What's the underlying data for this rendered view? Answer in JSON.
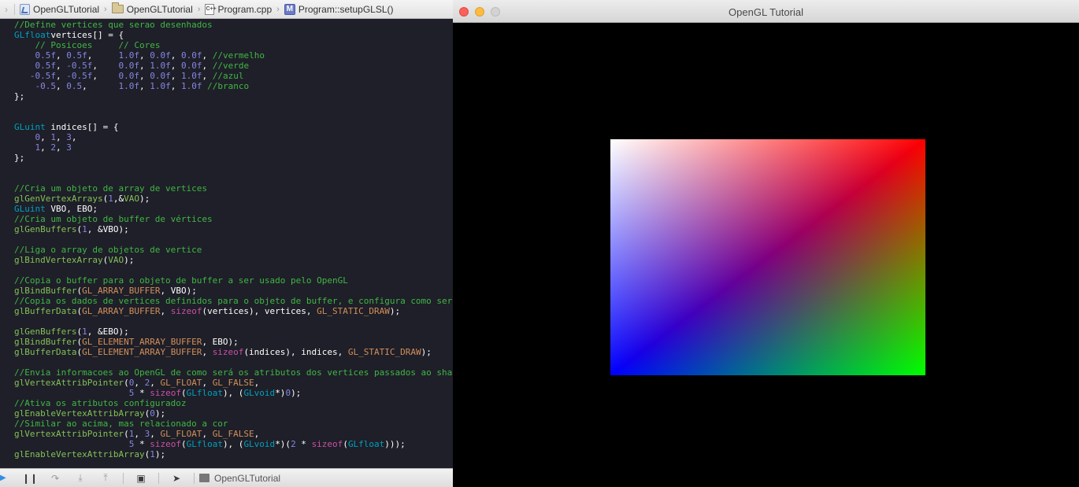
{
  "editor": {
    "jumpbar": {
      "crumbs": [
        "OpenGLTutorial",
        "OpenGLTutorial",
        "Program.cpp",
        "Program::setupGLSL()"
      ],
      "cpp_badge": "C++",
      "method_badge": "M"
    },
    "code": [
      [
        [
          "cm",
          "//Define vertices que serao desenhados"
        ]
      ],
      [
        [
          "ty",
          "GLfloat"
        ],
        [
          "",
          "vertices[] = {"
        ]
      ],
      [
        [
          "",
          "    "
        ],
        [
          "cm",
          "// Posicoes     // Cores"
        ]
      ],
      [
        [
          "",
          "    "
        ],
        [
          "nu",
          "0.5f"
        ],
        [
          "",
          ", "
        ],
        [
          "nu",
          "0.5f"
        ],
        [
          "",
          ",     "
        ],
        [
          "nu",
          "1.0f"
        ],
        [
          "",
          ", "
        ],
        [
          "nu",
          "0.0f"
        ],
        [
          "",
          ", "
        ],
        [
          "nu",
          "0.0f"
        ],
        [
          "",
          ", "
        ],
        [
          "cm",
          "//vermelho"
        ]
      ],
      [
        [
          "",
          "    "
        ],
        [
          "nu",
          "0.5f"
        ],
        [
          "",
          ", "
        ],
        [
          "nu",
          "-0.5f"
        ],
        [
          "",
          ",    "
        ],
        [
          "nu",
          "0.0f"
        ],
        [
          "",
          ", "
        ],
        [
          "nu",
          "1.0f"
        ],
        [
          "",
          ", "
        ],
        [
          "nu",
          "0.0f"
        ],
        [
          "",
          ", "
        ],
        [
          "cm",
          "//verde"
        ]
      ],
      [
        [
          "",
          "   "
        ],
        [
          "nu",
          "-0.5f"
        ],
        [
          "",
          ", "
        ],
        [
          "nu",
          "-0.5f"
        ],
        [
          "",
          ",    "
        ],
        [
          "nu",
          "0.0f"
        ],
        [
          "",
          ", "
        ],
        [
          "nu",
          "0.0f"
        ],
        [
          "",
          ", "
        ],
        [
          "nu",
          "1.0f"
        ],
        [
          "",
          ", "
        ],
        [
          "cm",
          "//azul"
        ]
      ],
      [
        [
          "",
          "    "
        ],
        [
          "nu",
          "-0.5"
        ],
        [
          "",
          ", "
        ],
        [
          "nu",
          "0.5"
        ],
        [
          "",
          ",      "
        ],
        [
          "nu",
          "1.0f"
        ],
        [
          "",
          ", "
        ],
        [
          "nu",
          "1.0f"
        ],
        [
          "",
          ", "
        ],
        [
          "nu",
          "1.0f"
        ],
        [
          "cm",
          " //branco"
        ]
      ],
      [
        [
          "",
          "};"
        ]
      ],
      [],
      [],
      [
        [
          "ty",
          "GLuint"
        ],
        [
          "",
          " indices[] = {"
        ]
      ],
      [
        [
          "",
          "    "
        ],
        [
          "nu",
          "0"
        ],
        [
          "",
          ", "
        ],
        [
          "nu",
          "1"
        ],
        [
          "",
          ", "
        ],
        [
          "nu",
          "3"
        ],
        [
          "",
          ","
        ]
      ],
      [
        [
          "",
          "    "
        ],
        [
          "nu",
          "1"
        ],
        [
          "",
          ", "
        ],
        [
          "nu",
          "2"
        ],
        [
          "",
          ", "
        ],
        [
          "nu",
          "3"
        ]
      ],
      [
        [
          "",
          "};"
        ]
      ],
      [],
      [],
      [
        [
          "cm",
          "//Cria um objeto de array de vertices"
        ]
      ],
      [
        [
          "fn",
          "glGenVertexArrays"
        ],
        [
          "",
          "("
        ],
        [
          "nu",
          "1"
        ],
        [
          "",
          ",&"
        ],
        [
          "fn",
          "VAO"
        ],
        [
          "",
          ");"
        ]
      ],
      [
        [
          "ty",
          "GLuint"
        ],
        [
          "",
          " VBO, EBO;"
        ]
      ],
      [
        [
          "cm",
          "//Cria um objeto de buffer de vértices"
        ]
      ],
      [
        [
          "fn",
          "glGenBuffers"
        ],
        [
          "",
          "("
        ],
        [
          "nu",
          "1"
        ],
        [
          "",
          ", &VBO);"
        ]
      ],
      [],
      [
        [
          "cm",
          "//Liga o array de objetos de vertice"
        ]
      ],
      [
        [
          "fn",
          "glBindVertexArray"
        ],
        [
          "",
          "("
        ],
        [
          "fn",
          "VAO"
        ],
        [
          "",
          ");"
        ]
      ],
      [],
      [
        [
          "cm",
          "//Copia o buffer para o objeto de buffer a ser usado pelo OpenGL"
        ]
      ],
      [
        [
          "fn",
          "glBindBuffer"
        ],
        [
          "",
          "("
        ],
        [
          "mc",
          "GL_ARRAY_BUFFER"
        ],
        [
          "",
          ", VBO);"
        ]
      ],
      [
        [
          "cm",
          "//Copia os dados de vertices definidos para o objeto de buffer, e configura como ser"
        ]
      ],
      [
        [
          "fn",
          "glBufferData"
        ],
        [
          "",
          "("
        ],
        [
          "mc",
          "GL_ARRAY_BUFFER"
        ],
        [
          "",
          ", "
        ],
        [
          "kw",
          "sizeof"
        ],
        [
          "",
          "(vertices), vertices, "
        ],
        [
          "mc",
          "GL_STATIC_DRAW"
        ],
        [
          "",
          ");"
        ]
      ],
      [],
      [
        [
          "fn",
          "glGenBuffers"
        ],
        [
          "",
          "("
        ],
        [
          "nu",
          "1"
        ],
        [
          "",
          ", &EBO);"
        ]
      ],
      [
        [
          "fn",
          "glBindBuffer"
        ],
        [
          "",
          "("
        ],
        [
          "mc",
          "GL_ELEMENT_ARRAY_BUFFER"
        ],
        [
          "",
          ", EBO);"
        ]
      ],
      [
        [
          "fn",
          "glBufferData"
        ],
        [
          "",
          "("
        ],
        [
          "mc",
          "GL_ELEMENT_ARRAY_BUFFER"
        ],
        [
          "",
          ", "
        ],
        [
          "kw",
          "sizeof"
        ],
        [
          "",
          "(indices), indices, "
        ],
        [
          "mc",
          "GL_STATIC_DRAW"
        ],
        [
          "",
          ");"
        ]
      ],
      [],
      [
        [
          "cm",
          "//Envia informacoes ao OpenGL de como será os atributos dos vertices passados ao sha"
        ]
      ],
      [
        [
          "fn",
          "glVertexAttribPointer"
        ],
        [
          "",
          "("
        ],
        [
          "nu",
          "0"
        ],
        [
          "",
          ", "
        ],
        [
          "nu",
          "2"
        ],
        [
          "",
          ", "
        ],
        [
          "mc",
          "GL_FLOAT"
        ],
        [
          "",
          ", "
        ],
        [
          "mc",
          "GL_FALSE"
        ],
        [
          "",
          ","
        ]
      ],
      [
        [
          "",
          "                      "
        ],
        [
          "nu",
          "5"
        ],
        [
          "",
          " * "
        ],
        [
          "kw",
          "sizeof"
        ],
        [
          "",
          "("
        ],
        [
          "ty",
          "GLfloat"
        ],
        [
          "",
          "), ("
        ],
        [
          "ty",
          "GLvoid"
        ],
        [
          "",
          "*)"
        ],
        [
          "nu",
          "0"
        ],
        [
          "",
          ");"
        ]
      ],
      [
        [
          "cm",
          "//Ativa os atributos configuradoz"
        ]
      ],
      [
        [
          "fn",
          "glEnableVertexAttribArray"
        ],
        [
          "",
          "("
        ],
        [
          "nu",
          "0"
        ],
        [
          "",
          ");"
        ]
      ],
      [
        [
          "cm",
          "//Similar ao acima, mas relacionado a cor"
        ]
      ],
      [
        [
          "fn",
          "glVertexAttribPointer"
        ],
        [
          "",
          "("
        ],
        [
          "nu",
          "1"
        ],
        [
          "",
          ", "
        ],
        [
          "nu",
          "3"
        ],
        [
          "",
          ", "
        ],
        [
          "mc",
          "GL_FLOAT"
        ],
        [
          "",
          ", "
        ],
        [
          "mc",
          "GL_FALSE"
        ],
        [
          "",
          ","
        ]
      ],
      [
        [
          "",
          "                      "
        ],
        [
          "nu",
          "5"
        ],
        [
          "",
          " * "
        ],
        [
          "kw",
          "sizeof"
        ],
        [
          "",
          "("
        ],
        [
          "ty",
          "GLfloat"
        ],
        [
          "",
          "), ("
        ],
        [
          "ty",
          "GLvoid"
        ],
        [
          "",
          "*)("
        ],
        [
          "nu",
          "2"
        ],
        [
          "",
          " * "
        ],
        [
          "kw",
          "sizeof"
        ],
        [
          "",
          "("
        ],
        [
          "ty",
          "GLfloat"
        ],
        [
          "",
          ")));"
        ]
      ],
      [
        [
          "fn",
          "glEnableVertexAttribArray"
        ],
        [
          "",
          "("
        ],
        [
          "nu",
          "1"
        ],
        [
          "",
          ");"
        ]
      ]
    ],
    "debugbar": {
      "target": "OpenGLTutorial"
    }
  },
  "window": {
    "title": "OpenGL Tutorial",
    "clear_color": "#000000",
    "vertex_colors": {
      "top_right": "#ff0000",
      "bottom_right": "#00ff00",
      "bottom_left": "#0000ff",
      "top_left": "#ffffff"
    }
  },
  "colors": {
    "editor_bg": "#1e1f28",
    "comment": "#41b645",
    "type": "#00a0be",
    "function": "#83c057",
    "macro": "#d28f5a",
    "number": "#8686e5",
    "keyword": "#cc4fa7"
  }
}
